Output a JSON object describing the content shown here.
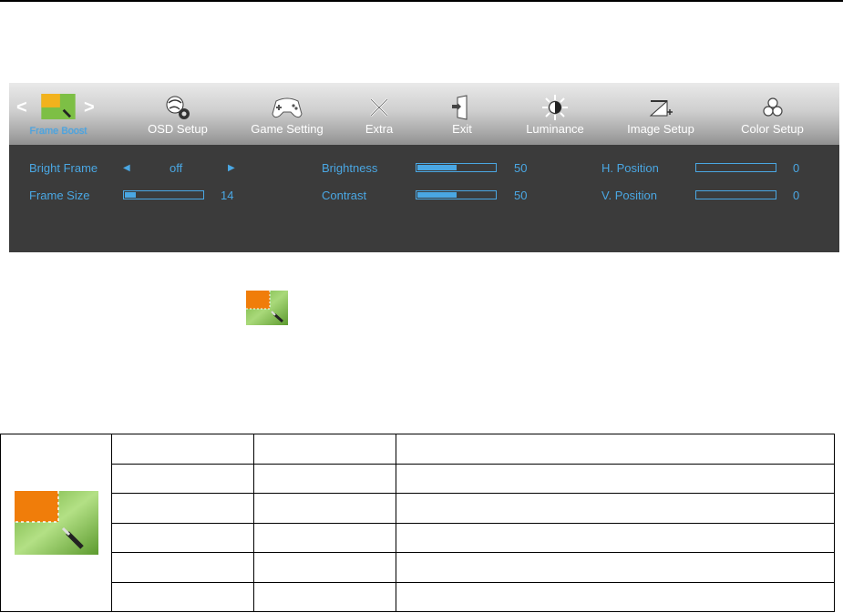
{
  "menu": {
    "active_label": "Frame Boost",
    "items": [
      {
        "label": "OSD Setup",
        "icon": "gear-globe-icon"
      },
      {
        "label": "Game Setting",
        "icon": "gamepad-icon"
      },
      {
        "label": "Extra",
        "icon": "tools-icon"
      },
      {
        "label": "Exit",
        "icon": "exit-door-icon"
      },
      {
        "label": "Luminance",
        "icon": "sun-icon"
      },
      {
        "label": "Image Setup",
        "icon": "image-setup-icon"
      },
      {
        "label": "Color Setup",
        "icon": "color-circles-icon"
      }
    ]
  },
  "options": {
    "bright_frame": {
      "label": "Bright Frame",
      "value": "off"
    },
    "frame_size": {
      "label": "Frame Size",
      "value": "14",
      "level": 14
    },
    "brightness": {
      "label": "Brightness",
      "value": "50",
      "level": 50
    },
    "contrast": {
      "label": "Contrast",
      "value": "50",
      "level": 50
    },
    "h_position": {
      "label": "H. Position",
      "value": "0",
      "level": 0
    },
    "v_position": {
      "label": "V. Position",
      "value": "0",
      "level": 0
    }
  },
  "colors": {
    "accent": "#4aa7e3",
    "panel": "#3b3b3b",
    "icon_orange": "#f07d0a",
    "icon_green": "#7dbf45"
  },
  "table": {
    "rows": [
      [
        "",
        "",
        ""
      ],
      [
        "",
        "",
        ""
      ],
      [
        "",
        "",
        ""
      ],
      [
        "",
        "",
        ""
      ],
      [
        "",
        "",
        ""
      ],
      [
        "",
        "",
        ""
      ]
    ]
  }
}
